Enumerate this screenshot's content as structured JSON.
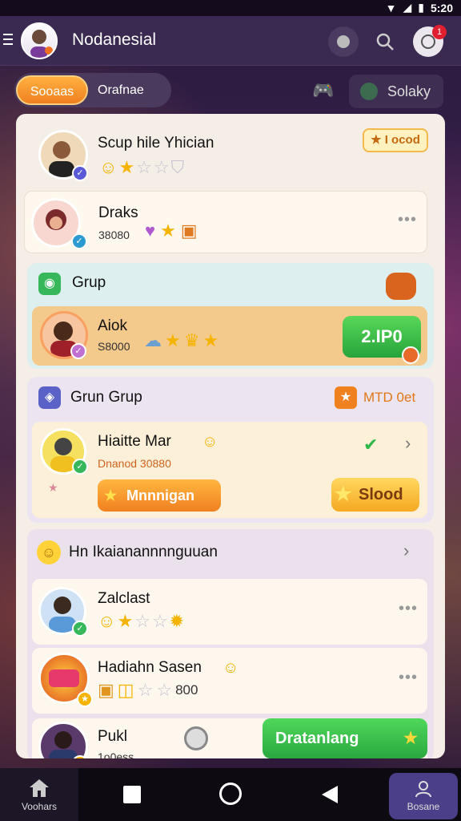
{
  "status": {
    "time": "5:20",
    "signal": "▼",
    "network": "◢",
    "battery": "▮"
  },
  "header": {
    "title": "Nodanesial",
    "notification_count": "1"
  },
  "tabs": {
    "active": "Sooaas",
    "inactive": "Orafnae"
  },
  "filter": {
    "label": "Solaky"
  },
  "panel": {
    "top_group": {
      "rows": [
        {
          "name": "Scup hile Yhician",
          "badge": "I ocod"
        },
        {
          "name": "Draks",
          "sub": "38080"
        }
      ]
    },
    "grup": {
      "title": "Grup",
      "row": {
        "name": "Aiok",
        "sub": "S8000",
        "cta": "2.IP0"
      }
    },
    "grun_grup": {
      "title": "Grun Grup",
      "badge": "MTD 0et",
      "row": {
        "name": "Hiaitte Mar",
        "sub": "Dnanod 30880",
        "btn_left": "Mnnnigan",
        "btn_right": "Slood"
      }
    },
    "main_section": {
      "title": "Hn Ikaianannnnguuan",
      "rows": [
        {
          "name": "Zalclast"
        },
        {
          "name": "Hadiahn Sasen",
          "sub": "800"
        },
        {
          "name": "Pukl",
          "sub": "1o0ess",
          "cta": "Dratanlang"
        }
      ]
    }
  },
  "navbar": {
    "left": "Voohars",
    "right": "Bosane"
  },
  "colors": {
    "accent_orange": "#f28a1e",
    "green": "#2fb84a",
    "panel": "#f5eee6",
    "appbar": "#3a2950"
  }
}
